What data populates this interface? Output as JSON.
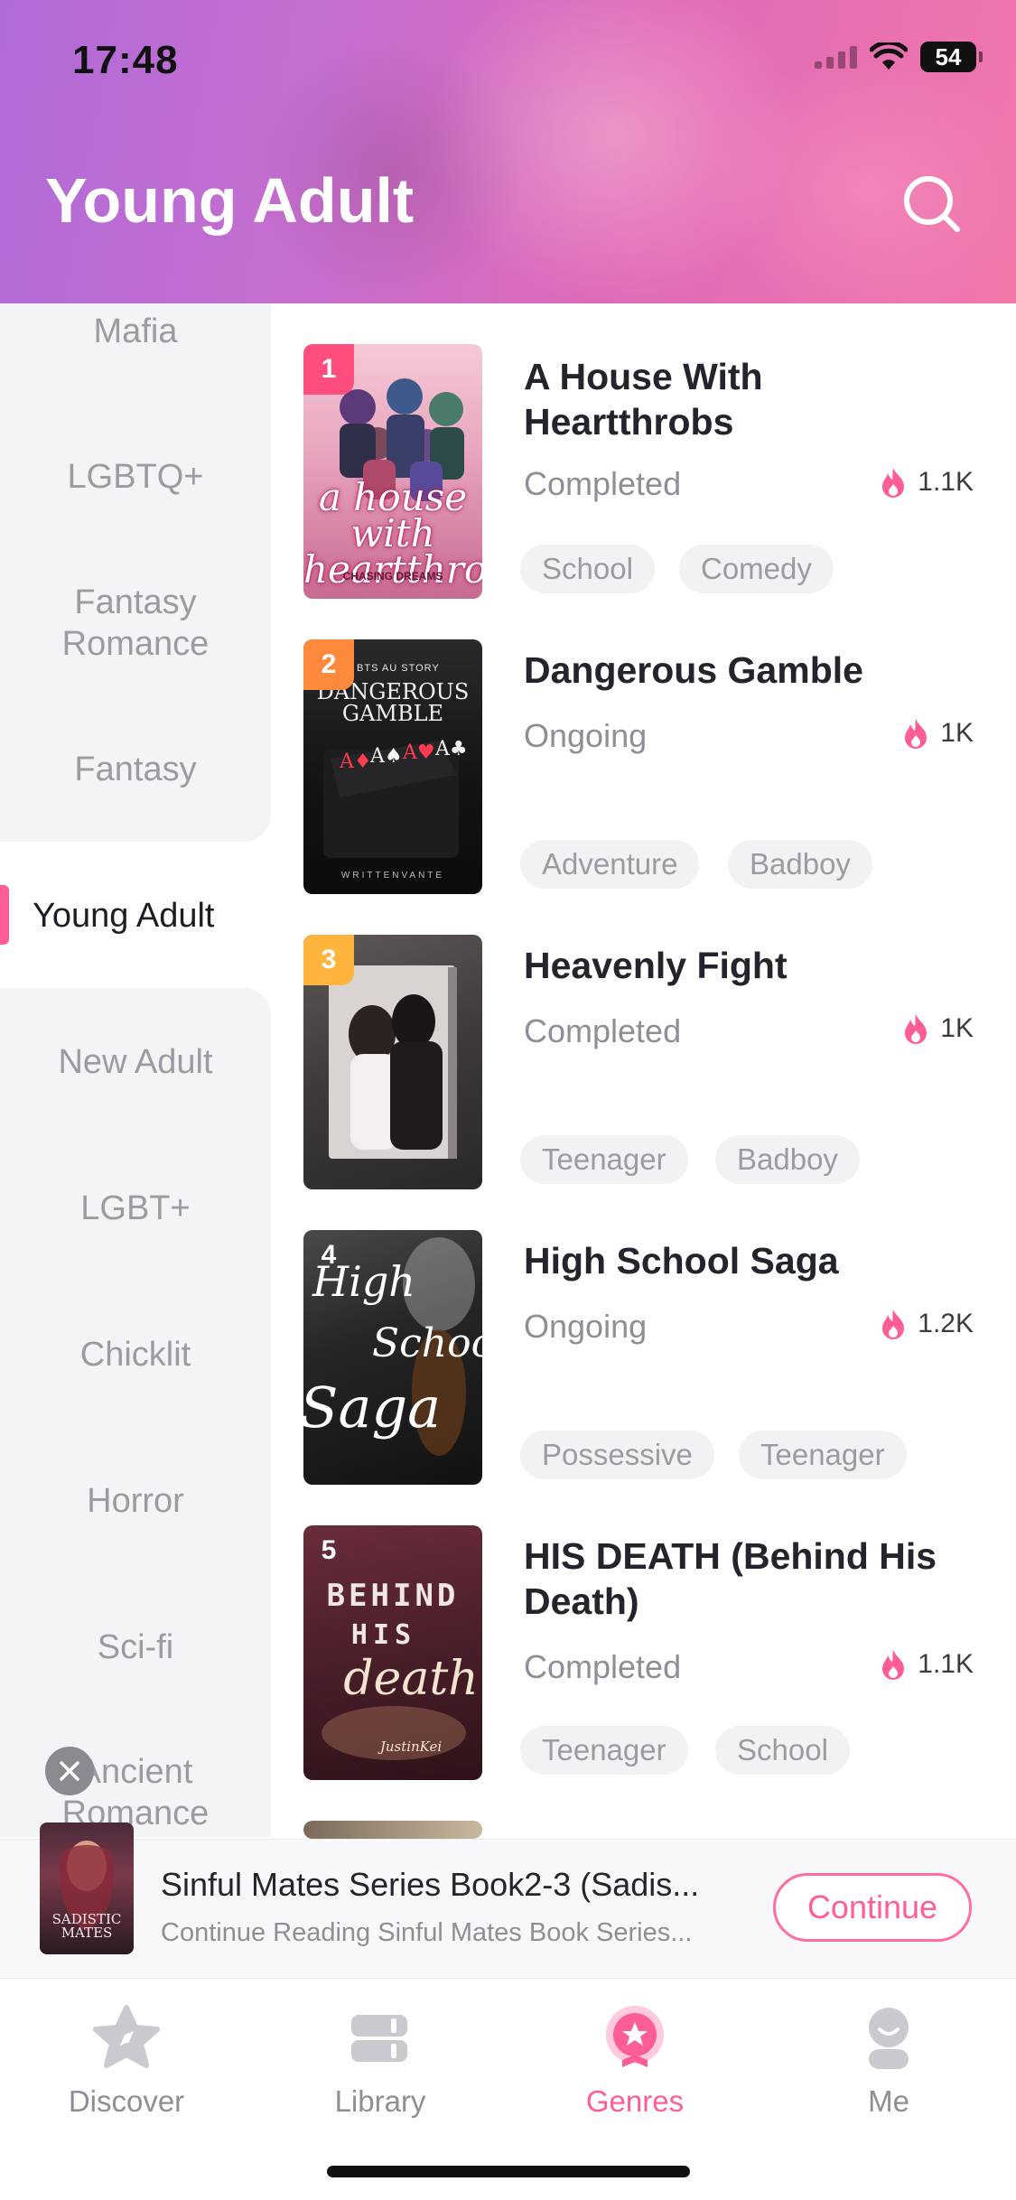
{
  "status_bar": {
    "time": "17:48",
    "battery": "54"
  },
  "header": {
    "title": "Young Adult"
  },
  "colors": {
    "accent": "#ff5d97",
    "rank1": "#ff4d7d",
    "rank2": "#ff8a3d",
    "rank3": "#ffb43d"
  },
  "sidebar": {
    "items": [
      {
        "label": "Mafia"
      },
      {
        "label": "LGBTQ+"
      },
      {
        "label": "Fantasy Romance"
      },
      {
        "label": "Fantasy"
      },
      {
        "label": "Young Adult",
        "active": true
      },
      {
        "label": "New Adult"
      },
      {
        "label": "LGBT+"
      },
      {
        "label": "Chicklit"
      },
      {
        "label": "Horror"
      },
      {
        "label": "Sci-fi"
      },
      {
        "label": "Ancient Romance"
      }
    ]
  },
  "books": [
    {
      "rank": "1",
      "title": "A House With Heartthrobs",
      "status": "Completed",
      "popularity": "1.1K",
      "tags": [
        "School",
        "Comedy"
      ],
      "cover_text": "a house with heartthrobs",
      "cover_subtext": "CHASING DREAMS"
    },
    {
      "rank": "2",
      "title": "Dangerous Gamble",
      "status": "Ongoing",
      "popularity": "1K",
      "tags": [
        "Adventure",
        "Badboy"
      ],
      "cover_text": "DANGEROUS GAMBLE",
      "cover_subtext": "WRITTENVANTE",
      "cover_kicker": "A BTS AU STORY"
    },
    {
      "rank": "3",
      "title": "Heavenly Fight",
      "status": "Completed",
      "popularity": "1K",
      "tags": [
        "Teenager",
        "Badboy"
      ]
    },
    {
      "rank": "4",
      "title": "High School Saga",
      "status": "Ongoing",
      "popularity": "1.2K",
      "tags": [
        "Possessive",
        "Teenager"
      ],
      "cover_text_1": "High",
      "cover_text_2": "School",
      "cover_text_3": "Saga"
    },
    {
      "rank": "5",
      "title": "HIS DEATH (Behind His Death)",
      "status": "Completed",
      "popularity": "1.1K",
      "tags": [
        "Teenager",
        "School"
      ],
      "cover_text_1": "BEHIND",
      "cover_text_2": "HIS",
      "cover_text_3": "death",
      "cover_subtext": "JustinKei"
    }
  ],
  "continue_reading": {
    "title": "Sinful Mates Series Book2-3 (Sadis...",
    "subtitle": "Continue Reading Sinful Mates Book Series...",
    "button": "Continue",
    "cover_text": "SADISTIC MATES"
  },
  "bottom_nav": [
    {
      "label": "Discover",
      "icon": "compass-star-icon"
    },
    {
      "label": "Library",
      "icon": "books-icon"
    },
    {
      "label": "Genres",
      "icon": "genres-badge-icon",
      "active": true
    },
    {
      "label": "Me",
      "icon": "profile-icon"
    }
  ]
}
